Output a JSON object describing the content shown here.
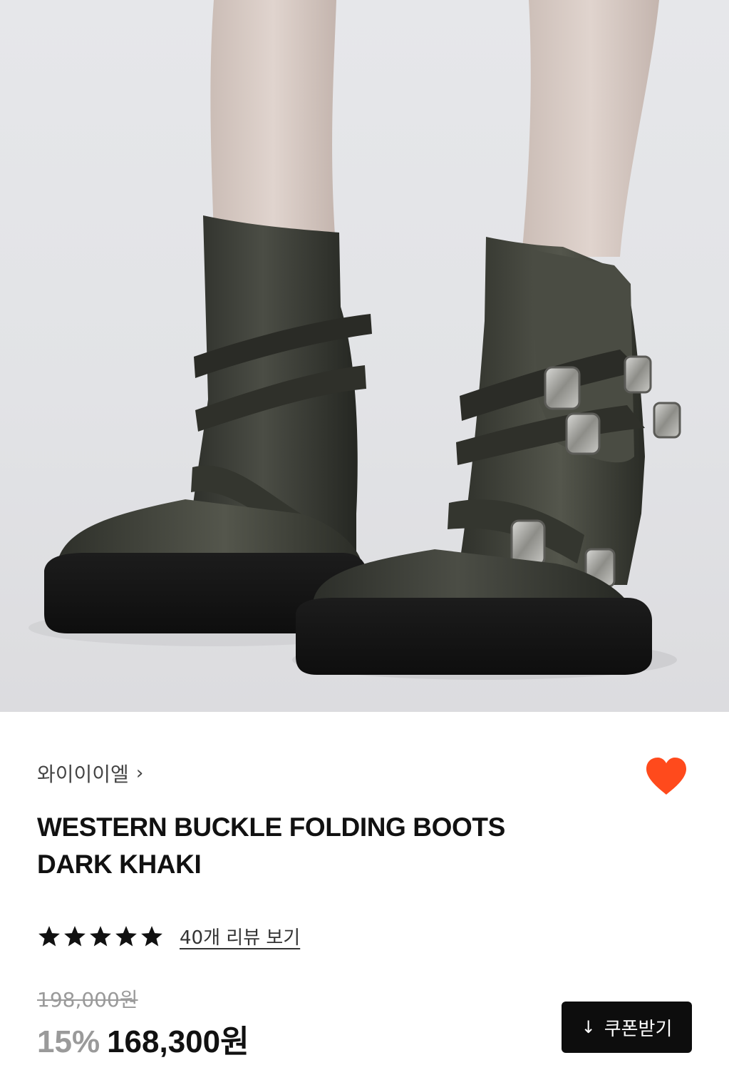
{
  "product": {
    "brand": "와이이이엘",
    "brand_chevron": "›",
    "title_line1": "WESTERN BUCKLE FOLDING BOOTS",
    "title_line2": "DARK KHAKI",
    "rating_stars": 5,
    "review_link": "40개 리뷰 보기",
    "original_price": "198,000원",
    "discount_rate": "15%",
    "sale_price": "168,300원",
    "coupon_icon": "↓",
    "coupon_label": "쿠폰받기",
    "wishlisted": true
  },
  "colors": {
    "heart": "#ff4a1c",
    "coupon_button_bg": "#0d0d0d",
    "muted_text": "#9a9a9a"
  },
  "icons": {
    "wishlist": "heart-icon",
    "rating": "star-icon",
    "coupon": "download-arrow-icon"
  }
}
